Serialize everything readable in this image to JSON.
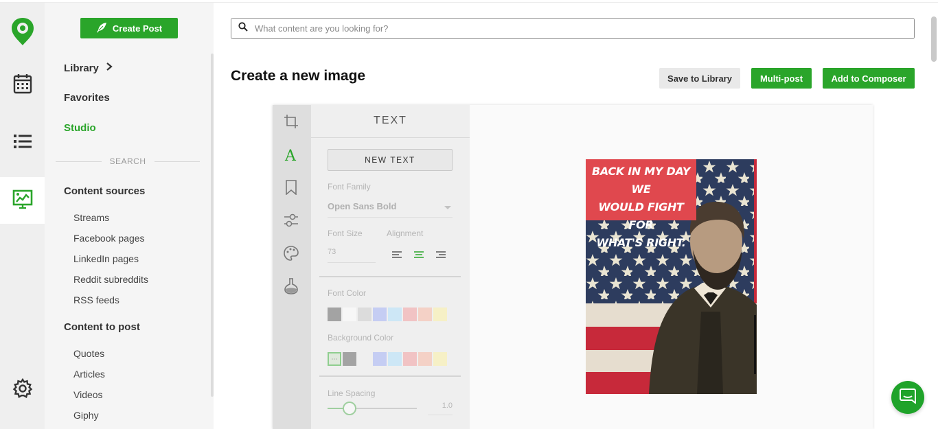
{
  "sidebar": {
    "create_post": "Create Post",
    "library": "Library",
    "favorites": "Favorites",
    "studio": "Studio",
    "search_label": "SEARCH",
    "content_sources": {
      "title": "Content sources",
      "items": [
        "Streams",
        "Facebook pages",
        "LinkedIn pages",
        "Reddit subreddits",
        "RSS feeds"
      ]
    },
    "content_to_post": {
      "title": "Content to post",
      "items": [
        "Quotes",
        "Articles",
        "Videos",
        "Giphy"
      ]
    }
  },
  "search": {
    "placeholder": "What content are you looking for?",
    "value": ""
  },
  "header": {
    "title": "Create a new image",
    "save_to_library": "Save to Library",
    "multi_post": "Multi-post",
    "add_to_composer": "Add to Composer"
  },
  "editor": {
    "panel_title": "TEXT",
    "new_text": "NEW TEXT",
    "font_family_label": "Font Family",
    "font_family_value": "Open Sans Bold",
    "font_size_label": "Font Size",
    "font_size_value": "73",
    "alignment_label": "Alignment",
    "alignment_selected": "center",
    "font_color_label": "Font Color",
    "background_color_label": "Background Color",
    "line_spacing_label": "Line Spacing",
    "line_spacing_value": "1.0",
    "font_colors": [
      "#a3a3a3",
      "#f7f7f7",
      "#dcdcdc",
      "#c5cdf3",
      "#cde7f6",
      "#f1c3c4",
      "#f4d1c6",
      "#f6f0c6"
    ],
    "background_colors": [
      "#dfe9dc",
      "#a3a3a3",
      "#efefef",
      "#c5cdf3",
      "#cde7f6",
      "#f1c3c4",
      "#f4d1c6",
      "#f6f0c6"
    ]
  },
  "image": {
    "quote_line1": "BACK IN MY DAY WE",
    "quote_line2": "WOULD FIGHT FOR",
    "quote_line3": "WHAT'S RIGHT."
  },
  "colors": {
    "brand_green": "#2aa52a",
    "quote_bg": "#e0484e"
  }
}
